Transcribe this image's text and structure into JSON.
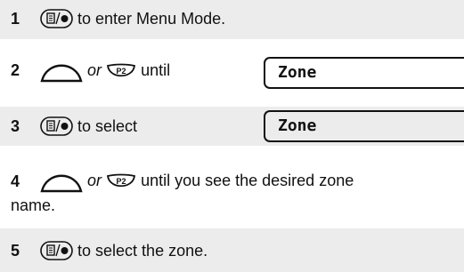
{
  "colors": {
    "shaded_row": "#ececec",
    "text": "#111111"
  },
  "icons": {
    "menu_select": "menu-select-key-icon",
    "scroll": "scroll-key-icon",
    "p2": "p2-button-icon"
  },
  "steps": [
    {
      "number": "1",
      "text": "to enter Menu Mode."
    },
    {
      "number": "2",
      "or": "or",
      "text": "until",
      "display": "Zone"
    },
    {
      "number": "3",
      "text": "to select",
      "display": "Zone"
    },
    {
      "number": "4",
      "or": "or",
      "text_line1": "until you see the desired zone",
      "text_line2": "name."
    },
    {
      "number": "5",
      "text": "to select the zone."
    }
  ]
}
